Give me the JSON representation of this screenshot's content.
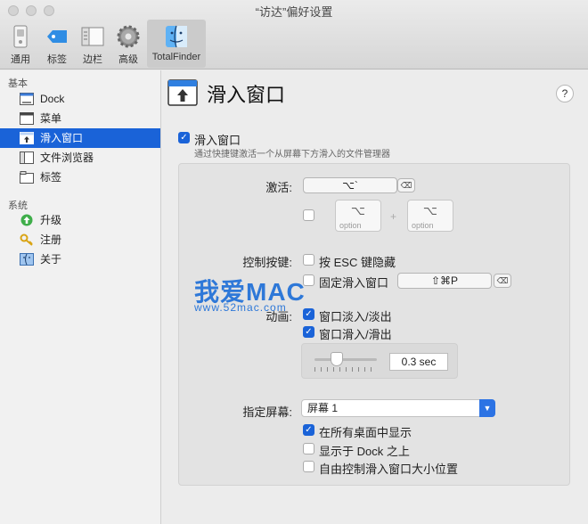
{
  "window": {
    "title": "“访达”偏好设置"
  },
  "toolbar": {
    "items": [
      {
        "label": "通用",
        "icon": "general-switch-icon"
      },
      {
        "label": "标签",
        "icon": "tag-icon"
      },
      {
        "label": "边栏",
        "icon": "sidebar-icon"
      },
      {
        "label": "高级",
        "icon": "gear-icon"
      },
      {
        "label": "TotalFinder",
        "icon": "finder-icon",
        "active": true
      }
    ]
  },
  "sidebar": {
    "sections": [
      {
        "header": "基本",
        "items": [
          {
            "label": "Dock",
            "icon": "dock-icon"
          },
          {
            "label": "菜单",
            "icon": "menu-icon"
          },
          {
            "label": "滑入窗口",
            "icon": "visor-window-icon",
            "selected": true
          },
          {
            "label": "文件浏览器",
            "icon": "file-browser-icon"
          },
          {
            "label": "标签",
            "icon": "tabs-icon"
          }
        ]
      },
      {
        "header": "系统",
        "items": [
          {
            "label": "升级",
            "icon": "upgrade-icon"
          },
          {
            "label": "注册",
            "icon": "key-icon"
          },
          {
            "label": "关于",
            "icon": "about-icon"
          }
        ]
      }
    ]
  },
  "main": {
    "title": "滑入窗口",
    "help_label": "?",
    "enable": {
      "label": "滑入窗口",
      "checked": true,
      "description": "通过快捷键激活一个从屏幕下方滑入的文件管理器"
    },
    "activation": {
      "label": "激活:",
      "shortcut": "⌥`",
      "clear_label": "⌫",
      "modifier_checked": false,
      "key1": {
        "symbol": "⌥",
        "name": "option"
      },
      "plus": "+",
      "key2": {
        "symbol": "⌥",
        "name": "option"
      }
    },
    "control_keys": {
      "label": "控制按键:",
      "esc_hide": {
        "label": "按 ESC 键隐藏",
        "checked": false
      },
      "pin": {
        "label": "固定滑入窗口",
        "checked": false,
        "shortcut": "⇧⌘P",
        "clear_label": "⌫"
      }
    },
    "animation": {
      "label": "动画:",
      "fade": {
        "label": "窗口淡入/淡出",
        "checked": true
      },
      "slide": {
        "label": "窗口滑入/滑出",
        "checked": true
      },
      "duration_value": "0.3 sec",
      "slider_level": 0.35
    },
    "screen": {
      "label": "指定屏幕:",
      "selected": "屏幕 1",
      "all_desktops": {
        "label": "在所有桌面中显示",
        "checked": true
      },
      "above_dock": {
        "label": "显示于 Dock 之上",
        "checked": false
      },
      "free_resize": {
        "label": "自由控制滑入窗口大小位置",
        "checked": false
      }
    }
  },
  "watermark": {
    "brand": "我爱MAC",
    "url": "www.52mac.com"
  },
  "colors": {
    "accent": "#1a63d8",
    "sidebar_bg": "#f1f1f1",
    "window_bg": "#ececec",
    "watermark": "#2e78d8"
  }
}
